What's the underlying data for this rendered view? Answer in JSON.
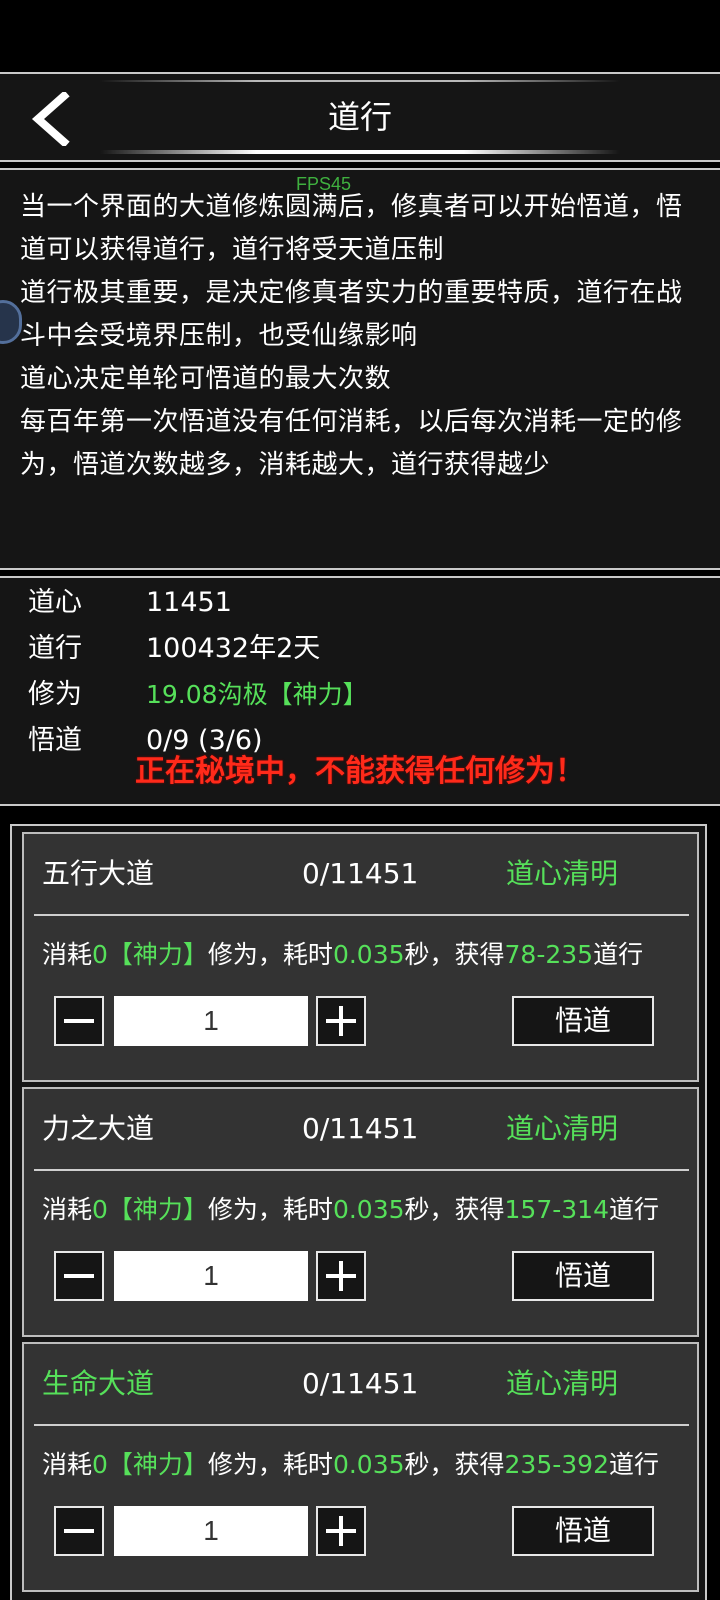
{
  "header": {
    "title": "道行"
  },
  "overlay": {
    "fps": "FPS45"
  },
  "description": {
    "lines": [
      "当一个界面的大道修炼圆满后，修真者可以开始悟道，悟",
      "道可以获得道行，道行将受天道压制",
      "道行极其重要，是决定修真者实力的重要特质，道行在战",
      "斗中会受境界压制，也受仙缘影响",
      "道心决定单轮可悟道的最大次数",
      "每百年第一次悟道没有任何消耗，以后每次消耗一定的修",
      "为，悟道次数越多，消耗越大，道行获得越少"
    ]
  },
  "stats": {
    "daoxin": {
      "label": "道心",
      "value": "11451"
    },
    "daoxing": {
      "label": "道行",
      "value": "100432年2天"
    },
    "xiuwei": {
      "label": "修为",
      "value": "19.08沟极【神力】"
    },
    "wudao": {
      "label": "悟道",
      "value": "0/9 (3/6)"
    },
    "warning": "正在秘境中，不能获得任何修为！"
  },
  "cards": [
    {
      "name": "五行大道",
      "progress": "0/11451",
      "status": "道心清明",
      "cost_prefix": "消耗",
      "cost_amount": "0【神力】",
      "cost_mid": "修为，耗时",
      "time": "0.035",
      "time_suffix": "秒，获得",
      "gain": "78-235",
      "gain_suffix": "道行",
      "quantity": "1",
      "action": "悟道"
    },
    {
      "name": "力之大道",
      "progress": "0/11451",
      "status": "道心清明",
      "cost_prefix": "消耗",
      "cost_amount": "0【神力】",
      "cost_mid": "修为，耗时",
      "time": "0.035",
      "time_suffix": "秒，获得",
      "gain": "157-314",
      "gain_suffix": "道行",
      "quantity": "1",
      "action": "悟道"
    },
    {
      "name": "生命大道",
      "progress": "0/11451",
      "status": "道心清明",
      "cost_prefix": "消耗",
      "cost_amount": "0【神力】",
      "cost_mid": "修为，耗时",
      "time": "0.035",
      "time_suffix": "秒，获得",
      "gain": "235-392",
      "gain_suffix": "道行",
      "quantity": "1",
      "action": "悟道"
    }
  ],
  "colors": {
    "accent_green": "#56e05a",
    "warning_red": "#ff2a1a",
    "panel_bg": "#151515",
    "card_bg": "#333333"
  }
}
